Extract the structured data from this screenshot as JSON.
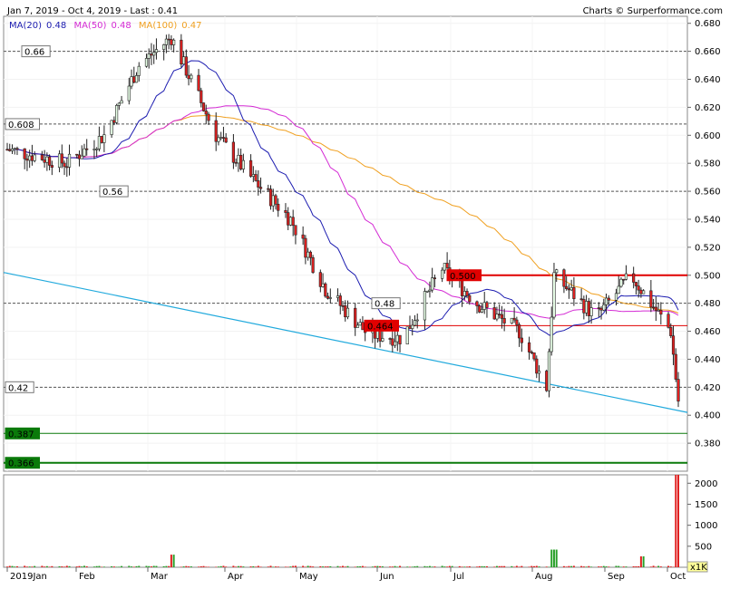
{
  "header": {
    "range": "Jan 7, 2019 - Oct 4, 2019 - Last : 0.41",
    "credit": "Charts © Surperformance.com"
  },
  "legend": [
    {
      "label": "MA(20)",
      "value": "0.48",
      "color": "#1c1cb0"
    },
    {
      "label": "MA(50)",
      "value": "0.48",
      "color": "#d42ad4"
    },
    {
      "label": "MA(100)",
      "value": "0.47",
      "color": "#f0a020"
    }
  ],
  "y_ticks": [
    "0.680",
    "0.660",
    "0.640",
    "0.620",
    "0.600",
    "0.580",
    "0.560",
    "0.540",
    "0.520",
    "0.500",
    "0.480",
    "0.460",
    "0.440",
    "0.420",
    "0.400",
    "0.380"
  ],
  "vol_ticks": [
    "2000",
    "1500",
    "1000",
    "500"
  ],
  "vol_unit": "x1K",
  "months": [
    "2019Jan",
    "Feb",
    "Mar",
    "Apr",
    "May",
    "Jun",
    "Jul",
    "Aug",
    "Sep",
    "Oct"
  ],
  "levels": [
    {
      "label": "0.66",
      "value": 0.66,
      "style": "dashed"
    },
    {
      "label": "0.608",
      "value": 0.608,
      "style": "dashed"
    },
    {
      "label": "0.56",
      "value": 0.56,
      "style": "dashed"
    },
    {
      "label": "0.48",
      "value": 0.48,
      "style": "dashed"
    },
    {
      "label": "0.42",
      "value": 0.42,
      "style": "dashed"
    },
    {
      "label": "0.500",
      "value": 0.5,
      "style": "red"
    },
    {
      "label": "0.464",
      "value": 0.464,
      "style": "red"
    },
    {
      "label": "0.387",
      "value": 0.387,
      "style": "green"
    },
    {
      "label": "0.366",
      "value": 0.366,
      "style": "green"
    }
  ],
  "colors": {
    "up": "#2aa02a",
    "down": "#e02020",
    "ma20": "#1c1cb0",
    "ma50": "#d42ad4",
    "ma100": "#f0a020",
    "trend": "#22aadd",
    "support": "#0a7a0a",
    "resistance": "#e00000"
  },
  "chart_data": {
    "type": "candlestick",
    "title": "Jan 7, 2019 - Oct 4, 2019 - Last : 0.41",
    "price_range": [
      0.36,
      0.685
    ],
    "volume_range": [
      0,
      2200
    ],
    "period": "2019-01-07 to 2019-10-04",
    "last": 0.41,
    "monthly_closes": [
      {
        "date": "2019-01-07",
        "close": 0.59
      },
      {
        "date": "2019-01-31",
        "close": 0.58
      },
      {
        "date": "2019-02-15",
        "close": 0.6
      },
      {
        "date": "2019-03-01",
        "close": 0.65
      },
      {
        "date": "2019-03-14",
        "close": 0.67
      },
      {
        "date": "2019-04-01",
        "close": 0.6
      },
      {
        "date": "2019-04-15",
        "close": 0.57
      },
      {
        "date": "2019-05-01",
        "close": 0.54
      },
      {
        "date": "2019-05-15",
        "close": 0.49
      },
      {
        "date": "2019-06-01",
        "close": 0.458
      },
      {
        "date": "2019-06-15",
        "close": 0.455
      },
      {
        "date": "2019-07-01",
        "close": 0.505
      },
      {
        "date": "2019-07-15",
        "close": 0.48
      },
      {
        "date": "2019-08-01",
        "close": 0.46
      },
      {
        "date": "2019-08-12",
        "close": 0.42
      },
      {
        "date": "2019-08-15",
        "close": 0.5
      },
      {
        "date": "2019-09-01",
        "close": 0.47
      },
      {
        "date": "2019-09-15",
        "close": 0.5
      },
      {
        "date": "2019-10-01",
        "close": 0.46
      },
      {
        "date": "2019-10-04",
        "close": 0.41
      }
    ],
    "moving_averages": [
      {
        "name": "MA(20)",
        "last": 0.48
      },
      {
        "name": "MA(50)",
        "last": 0.48
      },
      {
        "name": "MA(100)",
        "last": 0.47
      }
    ],
    "horizontal_levels": [
      0.66,
      0.608,
      0.56,
      0.5,
      0.48,
      0.464,
      0.42,
      0.387,
      0.366
    ],
    "trendline": {
      "from": {
        "date": "2019-01-07",
        "price": 0.502
      },
      "to": {
        "date": "2019-10-04",
        "price": 0.402
      }
    },
    "volume_spikes": [
      {
        "date": "2019-03-15",
        "volume": 300
      },
      {
        "date": "2019-08-15",
        "volume": 420
      },
      {
        "date": "2019-09-20",
        "volume": 260
      },
      {
        "date": "2019-10-04",
        "volume": 2200
      }
    ]
  }
}
